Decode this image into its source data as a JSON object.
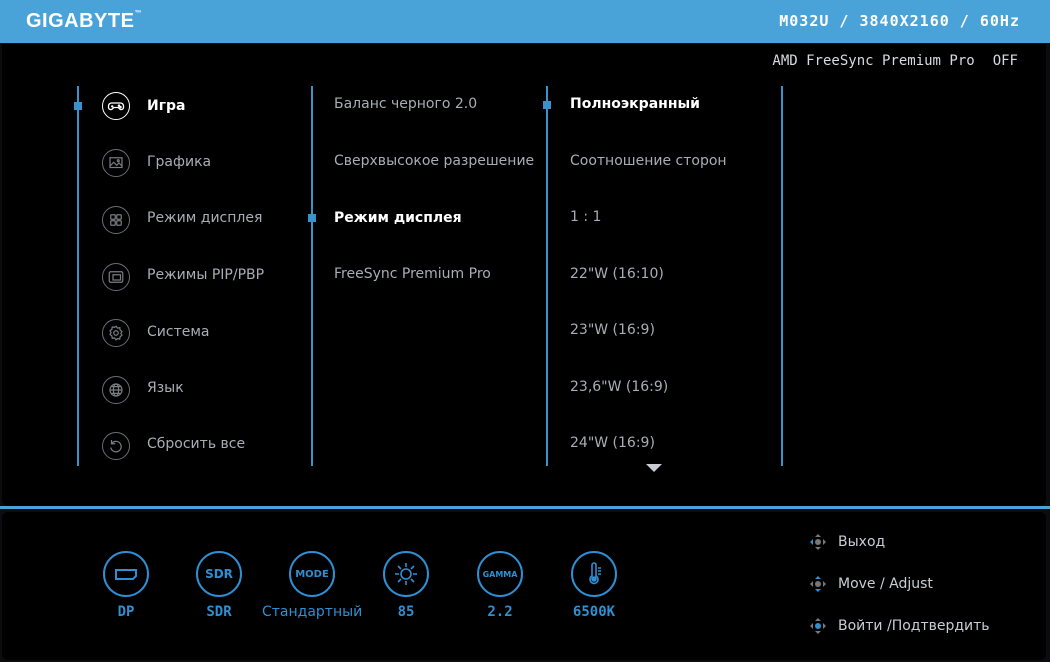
{
  "header": {
    "brand": "GIGABYTE",
    "model_info": "M032U / 3840X2160 / 60Hz"
  },
  "status": {
    "freesync_label": "AMD FreeSync Premium Pro",
    "freesync_value": "OFF"
  },
  "main_menu": [
    {
      "label": "Игра",
      "icon": "gamepad-icon",
      "active": true
    },
    {
      "label": "Графика",
      "icon": "picture-icon",
      "active": false
    },
    {
      "label": "Режим дисплея",
      "icon": "grid-icon",
      "active": false
    },
    {
      "label": "Режимы PIP/PBP",
      "icon": "pip-icon",
      "active": false
    },
    {
      "label": "Система",
      "icon": "gear-icon",
      "active": false
    },
    {
      "label": "Язык",
      "icon": "globe-icon",
      "active": false
    },
    {
      "label": "Сбросить все",
      "icon": "reset-icon",
      "active": false
    }
  ],
  "sub_menu": [
    {
      "label": "Баланс черного 2.0",
      "active": false
    },
    {
      "label": "Сверхвысокое разрешение",
      "active": false
    },
    {
      "label": "Режим дисплея",
      "active": true
    },
    {
      "label": "FreeSync Premium Pro",
      "active": false
    }
  ],
  "options": [
    {
      "label": "Полноэкранный",
      "active": true
    },
    {
      "label": "Соотношение сторон",
      "active": false
    },
    {
      "label": "1 : 1",
      "active": false
    },
    {
      "label": "22\"W (16:10)",
      "active": false
    },
    {
      "label": "23\"W (16:9)",
      "active": false
    },
    {
      "label": "23,6\"W (16:9)",
      "active": false
    },
    {
      "label": "24\"W (16:9)",
      "active": false
    }
  ],
  "quick": {
    "input_value": "DP",
    "sdr_icon_text": "SDR",
    "sdr_value": "SDR",
    "mode_icon_text": "MODE",
    "mode_value": "Стандартный",
    "brightness_value": "85",
    "gamma_icon_text": "GAMMA",
    "gamma_value": "2.2",
    "temp_value": "6500K"
  },
  "hints": {
    "exit": "Выход",
    "move": "Move / Adjust",
    "enter": "Войти /Подтвердить"
  },
  "colors": {
    "accent": "#4aa3d8",
    "quick_blue": "#2e8fd3",
    "background": "#000000"
  }
}
